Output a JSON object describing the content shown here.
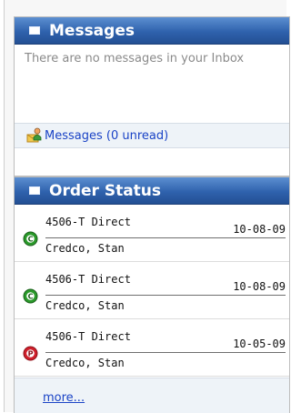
{
  "messages_panel": {
    "title": "Messages",
    "empty_text": "There are no messages in your Inbox",
    "link_label": "Messages (0 unread)",
    "link_icon": "mail-person-icon"
  },
  "order_panel": {
    "title": "Order Status",
    "orders": [
      {
        "product": "4506-T Direct",
        "date": "10-08-09",
        "name": "Credco, Stan",
        "status_letter": "C",
        "status_color": "#2a9a2a"
      },
      {
        "product": "4506-T Direct",
        "date": "10-08-09",
        "name": "Credco, Stan",
        "status_letter": "C",
        "status_color": "#2a9a2a"
      },
      {
        "product": "4506-T Direct",
        "date": "10-05-09",
        "name": "Credco, Stan",
        "status_letter": "P",
        "status_color": "#d01f2b"
      }
    ],
    "more_label": "more..."
  },
  "colors": {
    "header_blue": "#2f62ad",
    "link_blue": "#1a43c6",
    "row_tint": "#eef3f8"
  }
}
